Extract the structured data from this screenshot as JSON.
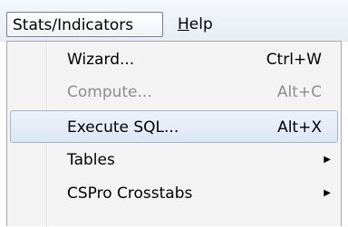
{
  "menubar": {
    "items": [
      {
        "label": "Stats/Indicators"
      },
      {
        "label_first": "H",
        "label_rest": "elp"
      }
    ]
  },
  "dropdown": {
    "items": [
      {
        "label": "Wizard...",
        "shortcut": "Ctrl+W",
        "state": "normal"
      },
      {
        "label": "Compute...",
        "shortcut": "Alt+C",
        "state": "disabled"
      },
      {
        "label": "Execute SQL...",
        "shortcut": "Alt+X",
        "state": "highlighted"
      },
      {
        "label": "Tables",
        "submenu_icon": "submenu-arrow-icon",
        "state": "normal"
      },
      {
        "label": "CSPro Crosstabs",
        "submenu_icon": "submenu-arrow-icon",
        "state": "normal"
      }
    ]
  },
  "colors": {
    "highlight_border": "#9fb6d6",
    "disabled_text": "#8d8d8d",
    "menu_background": "#f3f3f3"
  }
}
